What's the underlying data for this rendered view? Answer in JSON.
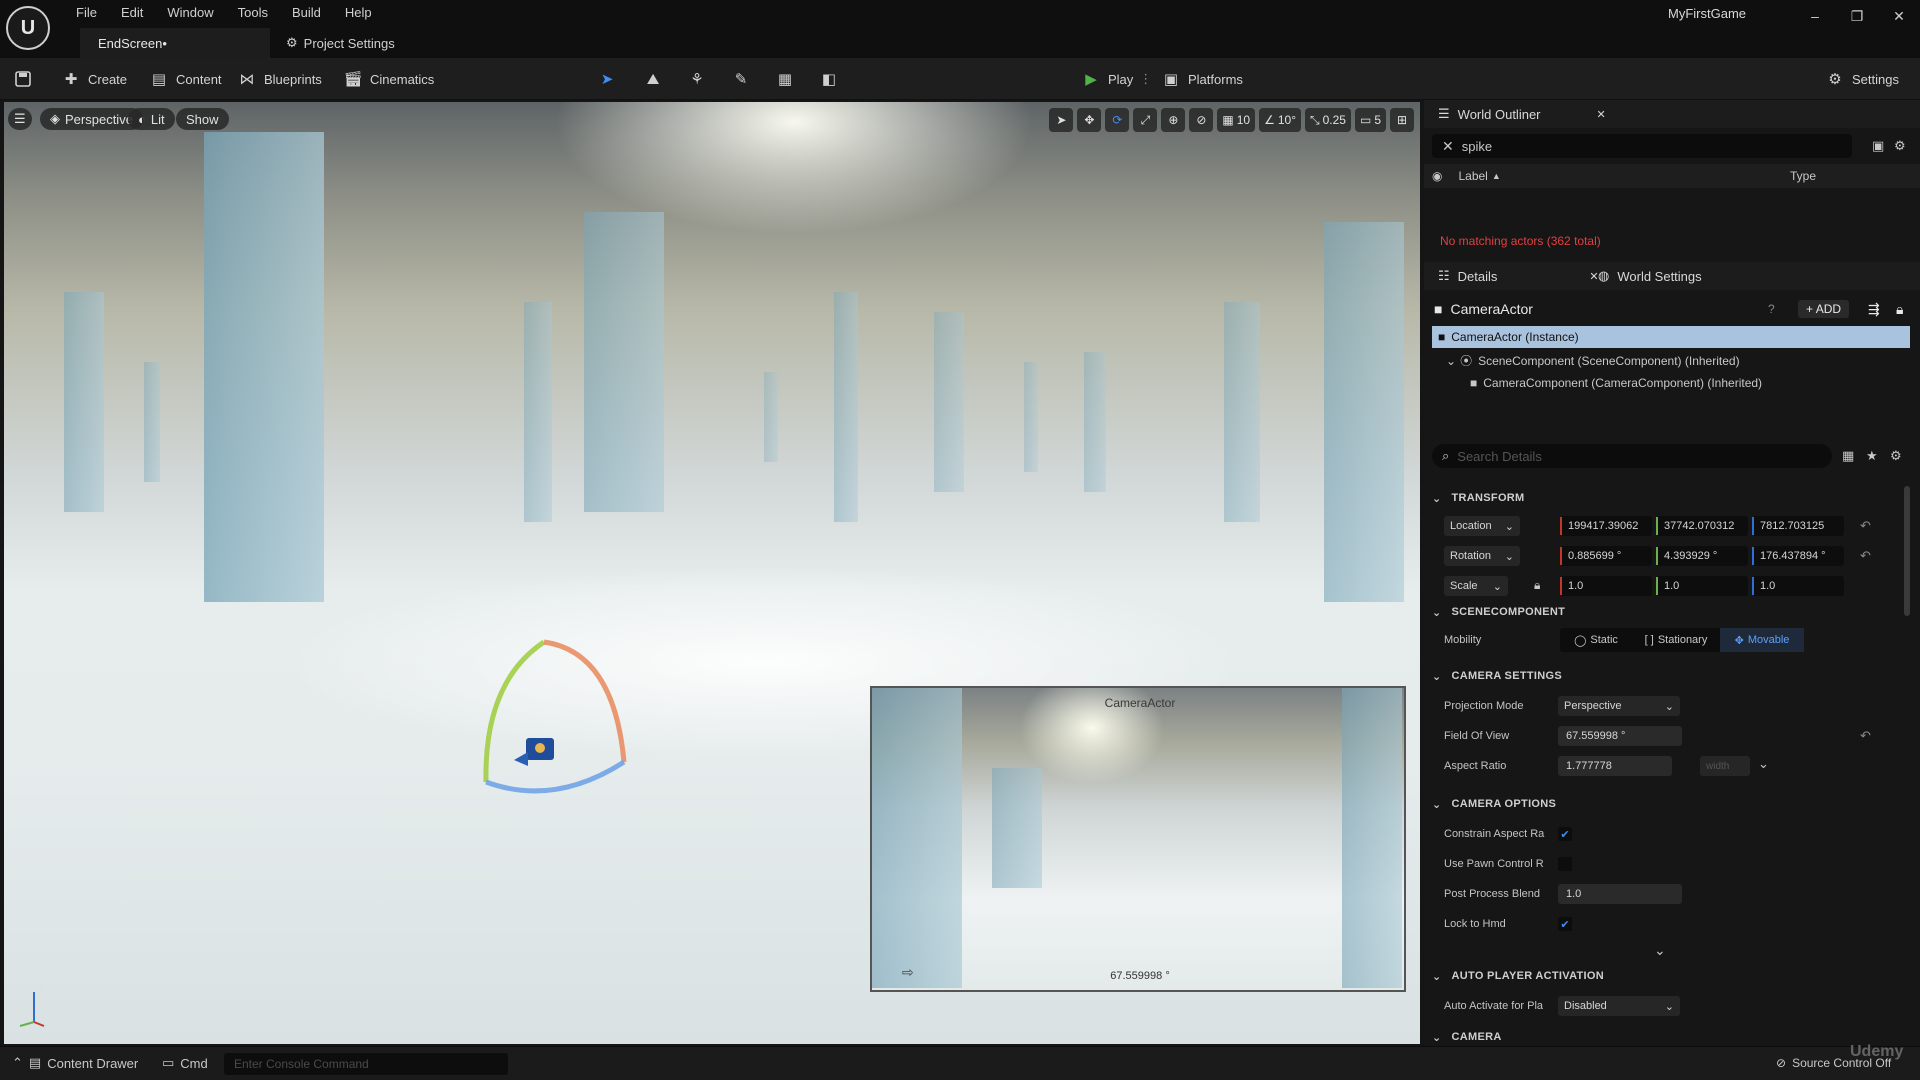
{
  "titlebar": {
    "logo": "U",
    "menu": [
      "File",
      "Edit",
      "Window",
      "Tools",
      "Build",
      "Help"
    ],
    "tabs": [
      "EndScreen•",
      "Project Settings"
    ],
    "app_title": "MyFirstGame",
    "window_buttons": [
      "–",
      "❐",
      "✕"
    ]
  },
  "toolbar": {
    "create": "Create",
    "content": "Content",
    "blueprints": "Blueprints",
    "cinematics": "Cinematics",
    "play": "Play",
    "platforms": "Platforms",
    "settings": "Settings"
  },
  "viewport": {
    "menu_icon": "hamburger-icon",
    "perspective": "Perspective",
    "lit": "Lit",
    "show": "Show",
    "grid_snap": "10",
    "rotation_snap": "10°",
    "scale_snap": "0.25",
    "camera_speed": "5",
    "preview": {
      "title": "CameraActor",
      "fov": "67.559998 °"
    }
  },
  "outliner": {
    "tab": "World Outliner",
    "search_value": "spike",
    "col_label": "Label",
    "col_type": "Type",
    "no_match": "No matching actors (362 total)"
  },
  "details": {
    "tab": "Details",
    "world_settings_tab": "World Settings",
    "actor_name": "CameraActor",
    "add_button": "ADD",
    "instance": "CameraActor (Instance)",
    "scene_component": "SceneComponent (SceneComponent) (Inherited)",
    "camera_component": "CameraComponent (CameraComponent) (Inherited)",
    "search_placeholder": "Search Details",
    "transform": {
      "header": "TRANSFORM",
      "location_label": "Location",
      "location": [
        "199417.39062",
        "37742.070312",
        "7812.703125"
      ],
      "rotation_label": "Rotation",
      "rotation": [
        "0.885699 °",
        "4.393929 °",
        "176.437894 °"
      ],
      "scale_label": "Scale",
      "scale": [
        "1.0",
        "1.0",
        "1.0"
      ]
    },
    "scenecomponent": {
      "header": "SCENECOMPONENT",
      "mobility_label": "Mobility",
      "options": [
        "Static",
        "Stationary",
        "Movable"
      ],
      "selected": "Movable"
    },
    "camera_settings": {
      "header": "CAMERA SETTINGS",
      "projection_label": "Projection Mode",
      "projection": "Perspective",
      "fov_label": "Field Of View",
      "fov": "67.559998 °",
      "aspect_label": "Aspect Ratio",
      "aspect": "1.777778",
      "aspect_unit": "width"
    },
    "camera_options": {
      "header": "CAMERA OPTIONS",
      "constrain_label": "Constrain Aspect Ra",
      "constrain": true,
      "pawn_label": "Use Pawn Control R",
      "pawn": false,
      "ppb_label": "Post Process Blend",
      "ppb": "1.0",
      "hmd_label": "Lock to Hmd",
      "hmd": true
    },
    "auto_player": {
      "header": "AUTO PLAYER ACTIVATION",
      "label": "Auto Activate for Pla",
      "value": "Disabled"
    },
    "next_header": "CAMERA"
  },
  "statusbar": {
    "content_drawer": "Content Drawer",
    "cmd": "Cmd",
    "console_placeholder": "Enter Console Command",
    "source_control": "Source Control Off",
    "watermark": "Udemy"
  },
  "colors": {
    "accent": "#3f8ef5",
    "play": "#4fb34a",
    "x_axis": "#c0392b",
    "y_axis": "#6ab04c",
    "z_axis": "#2e6fd1",
    "error": "#e04040"
  }
}
